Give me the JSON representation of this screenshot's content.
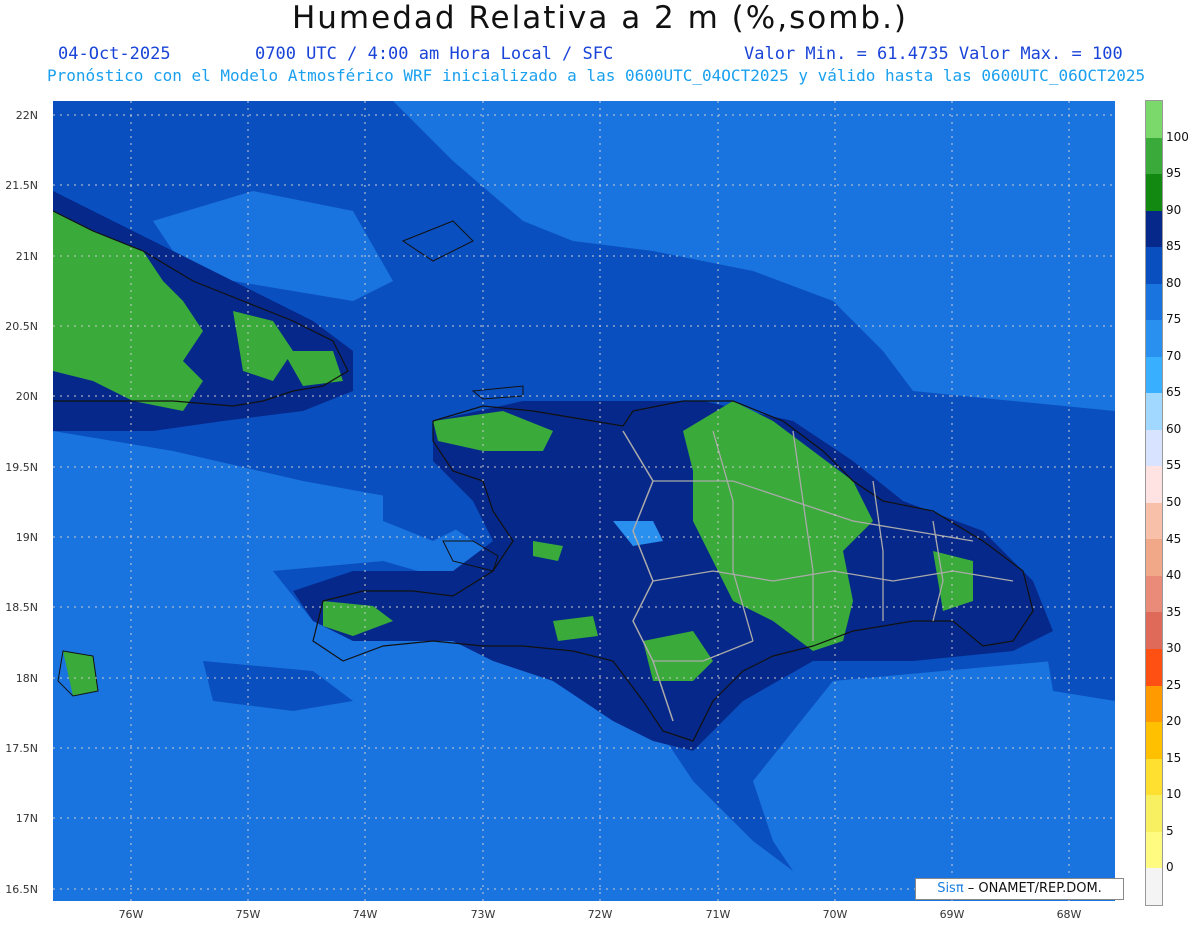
{
  "header": {
    "title": "Humedad Relativa a 2 m (%,somb.)",
    "date": "04-Oct-2025",
    "time": "0700 UTC / 4:00 am Hora Local / SFC",
    "minmax": "Valor Min. = 61.4735  Valor Max. = 100",
    "forecast": "Pronóstico con el Modelo Atmosférico WRF inicializado a las 0600UTC_04OCT2025 y válido hasta las  0600UTC_06OCT2025"
  },
  "axes": {
    "lat_labels": [
      "22N",
      "21.5N",
      "21N",
      "20.5N",
      "20N",
      "19.5N",
      "19N",
      "18.5N",
      "18N",
      "17.5N",
      "17N",
      "16.5N"
    ],
    "lon_labels": [
      "76W",
      "75W",
      "74W",
      "73W",
      "72W",
      "71W",
      "70W",
      "69W",
      "68W"
    ]
  },
  "credit": {
    "brand": "Sisπ",
    "text": " – ONAMET/REP.DOM."
  },
  "colorbar": {
    "labels": [
      "100",
      "95",
      "90",
      "85",
      "80",
      "75",
      "70",
      "65",
      "60",
      "55",
      "50",
      "45",
      "40",
      "35",
      "30",
      "25",
      "20",
      "15",
      "10",
      "5",
      "0"
    ],
    "colors": [
      "#7ad96a",
      "#3aaa3a",
      "#128a12",
      "#06288a",
      "#0a4fbf",
      "#1a74e0",
      "#2a90f0",
      "#38b0ff",
      "#a0d8ff",
      "#d8e4ff",
      "#ffe2e2",
      "#f8c0a8",
      "#f0a888",
      "#ea8a78",
      "#e06a5a",
      "#ff5014",
      "#ff9a00",
      "#ffc000",
      "#ffe030",
      "#f8f060",
      "#fffa80",
      "#f4f4f4"
    ]
  },
  "colors": {
    "land_border": "#111111",
    "province_border": "#aaaaaa",
    "grid": "#cccccc"
  }
}
